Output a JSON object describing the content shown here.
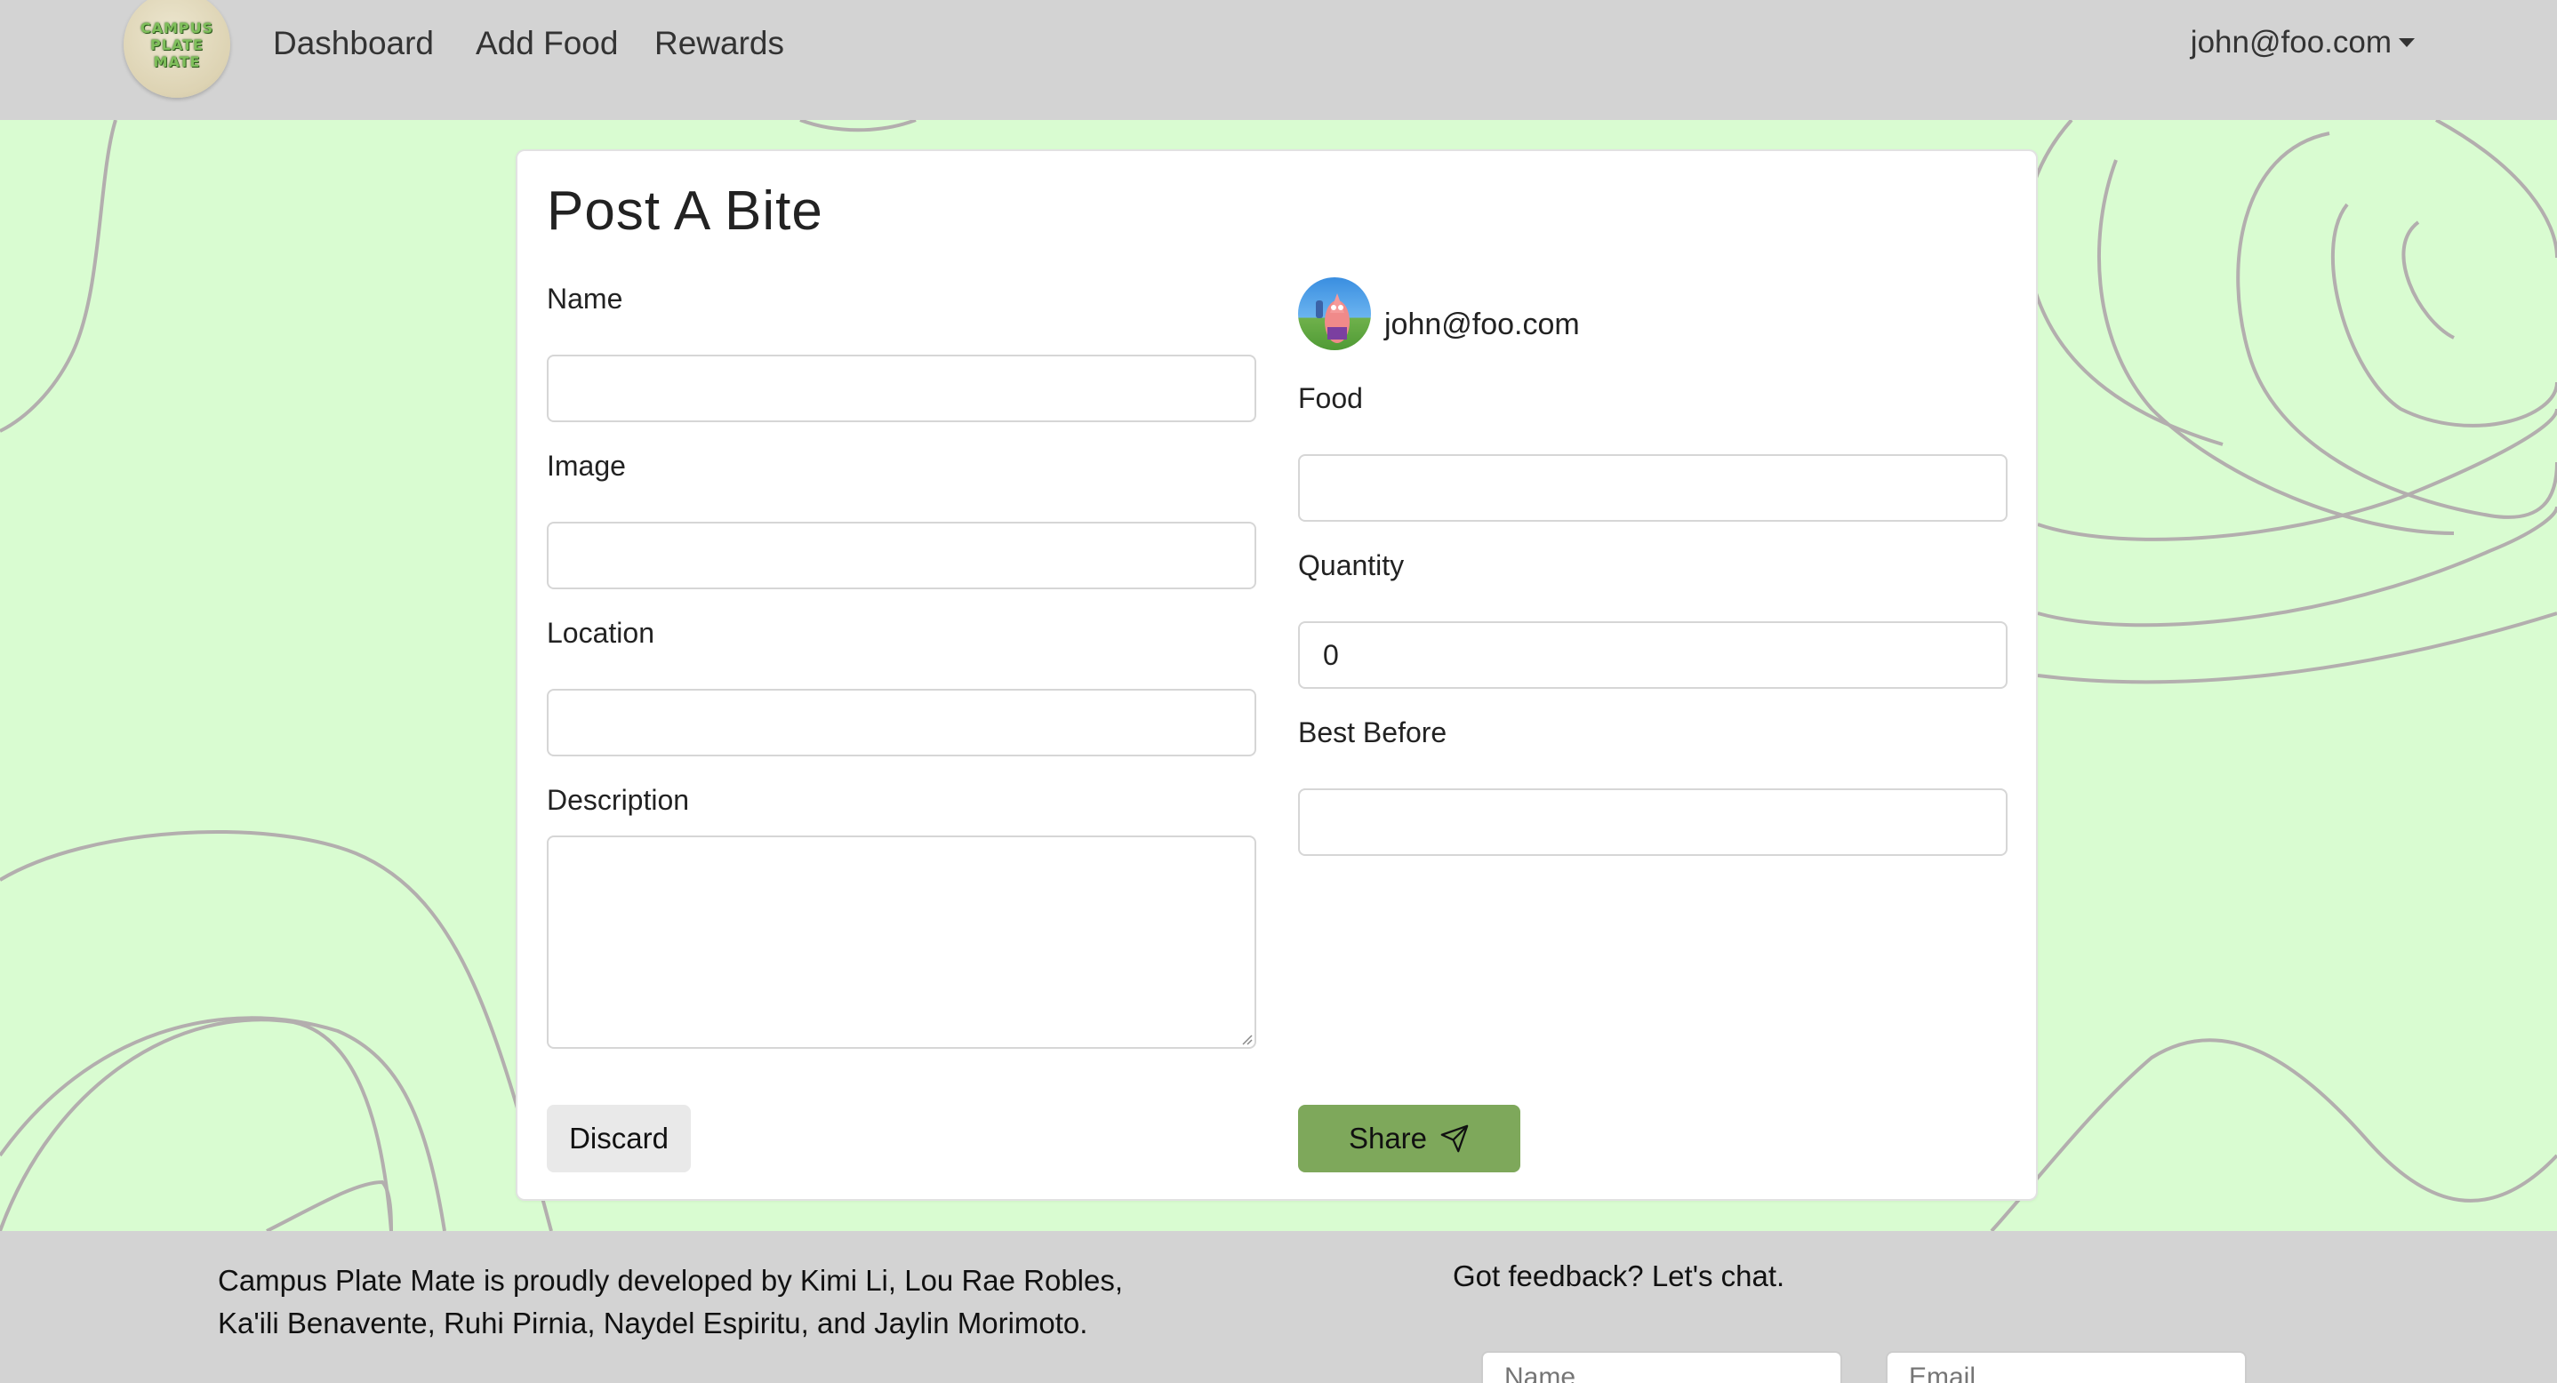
{
  "brand": {
    "logo_lines": [
      "CAMPUS",
      "PLATE",
      "MATE"
    ]
  },
  "nav": {
    "links": [
      "Dashboard",
      "Add Food",
      "Rewards"
    ],
    "user_email": "john@foo.com"
  },
  "form": {
    "title": "Post A Bite",
    "left_fields": {
      "name_label": "Name",
      "name_value": "",
      "image_label": "Image",
      "image_value": "",
      "location_label": "Location",
      "location_value": "",
      "description_label": "Description",
      "description_value": ""
    },
    "owner": {
      "email": "john@foo.com",
      "avatar_icon": "avatar-photo"
    },
    "right_fields": {
      "food_label": "Food",
      "food_value": "",
      "quantity_label": "Quantity",
      "quantity_value": "0",
      "best_before_label": "Best Before",
      "best_before_value": ""
    },
    "buttons": {
      "discard_label": "Discard",
      "share_label": "Share",
      "share_icon": "send-icon"
    }
  },
  "footer": {
    "credits_line1": "Campus Plate Mate is proudly developed by Kimi Li, Lou Rae Robles,",
    "credits_line2": "Ka'ili Benavente, Ruhi Pirnia, Naydel Espiritu, and Jaylin Morimoto.",
    "feedback_heading": "Got feedback? Let's chat.",
    "name_placeholder": "Name",
    "email_placeholder": "Email"
  },
  "colors": {
    "background": "#d9fcd1",
    "navbar": "#d3d3d3",
    "share_button": "#7ea85b",
    "discard_button": "#e9e9e9",
    "topo_lines": "#b3aeae"
  }
}
